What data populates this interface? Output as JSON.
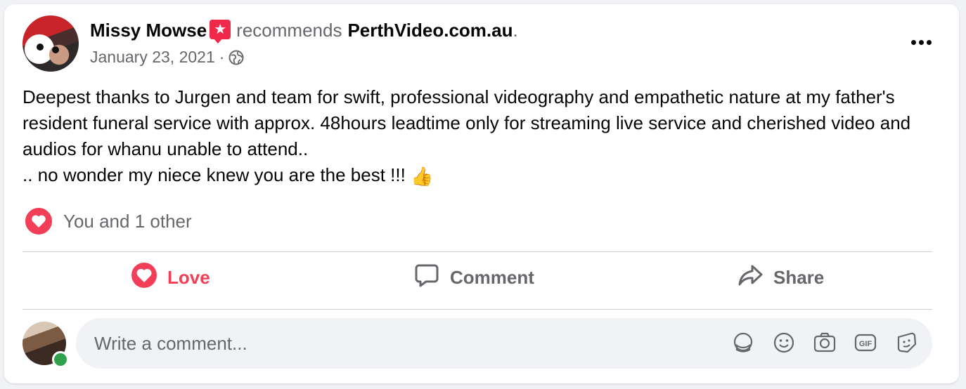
{
  "post": {
    "author": "Missy Mowse",
    "recommends_text": "recommends",
    "page_name": "PerthVideo.com.au",
    "page_suffix": ".",
    "date": "January 23, 2021",
    "date_separator": "·",
    "body": "Deepest thanks to Jurgen and team for swift, professional videography and empathetic nature at my father's resident funeral service with approx. 48hours leadtime only for streaming live service and cherished video and audios for whanu unable to attend..\n.. no wonder my niece knew you are the best !!! ",
    "emoji": "👍"
  },
  "reactions": {
    "summary": "You and 1 other"
  },
  "actions": {
    "love_label": "Love",
    "comment_label": "Comment",
    "share_label": "Share"
  },
  "comment": {
    "placeholder": "Write a comment..."
  },
  "colors": {
    "love_red": "#f33e58",
    "badge_red": "#f02849",
    "secondary_text": "#65676b",
    "online_green": "#31a24c"
  },
  "icons": [
    "recommend-badge-icon",
    "globe-icon",
    "more-icon",
    "heart-icon",
    "comment-icon",
    "share-icon",
    "sticker-icon",
    "emoji-icon",
    "camera-icon",
    "gif-icon",
    "avatar-sticker-icon"
  ]
}
